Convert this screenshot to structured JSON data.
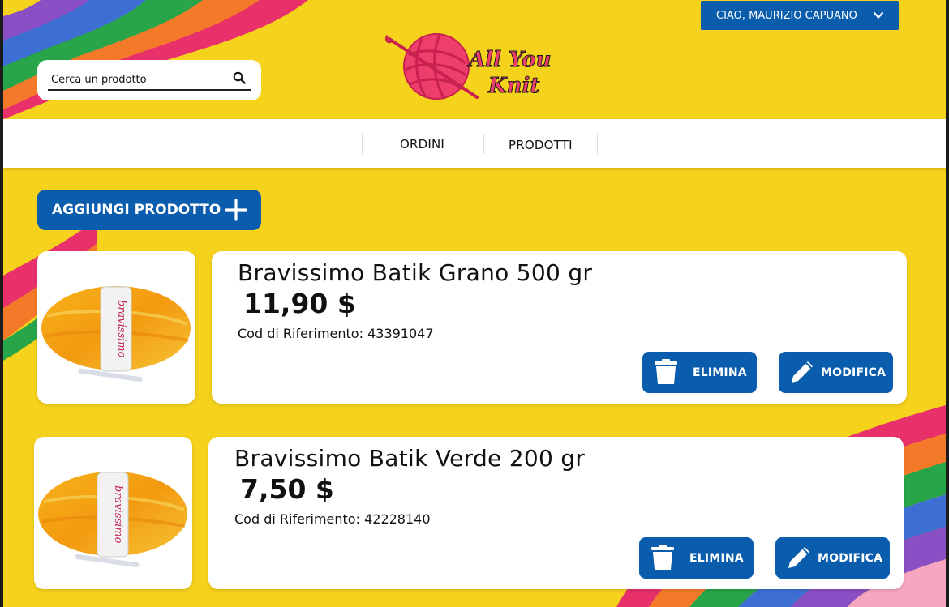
{
  "header": {
    "search_placeholder": "Cerca un prodotto",
    "user_greeting": "CIAO, MAURIZIO CAPUANO",
    "logo_text_line1": "All You",
    "logo_text_line2": "Knit"
  },
  "nav": {
    "items": [
      {
        "label": "ORDINI"
      },
      {
        "label": "PRODOTTI"
      }
    ]
  },
  "actions": {
    "add_product_label": "AGGIUNGI PRODOTTO",
    "delete_label": "ELIMINA",
    "edit_label": "MODIFICA"
  },
  "products": [
    {
      "name": "Bravissimo Batik Grano 500 gr",
      "price": "11,90 $",
      "code_label": "Cod di Riferimento:",
      "code": "43391047",
      "image_label": "bravissimo"
    },
    {
      "name": "Bravissimo Batik Verde 200 gr",
      "price": "7,50 $",
      "code_label": "Cod di Riferimento:",
      "code": "42228140",
      "image_label": "bravissimo"
    }
  ],
  "colors": {
    "background": "#f5d21c",
    "primary_blue": "#0a5cad",
    "logo_pink": "#ee3f6c"
  },
  "icons": [
    "search-icon",
    "chevron-down-icon",
    "plus-icon",
    "trash-icon",
    "pencil-icon",
    "yarn-ball-logo-icon"
  ]
}
